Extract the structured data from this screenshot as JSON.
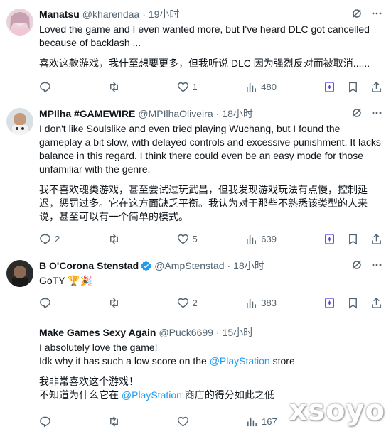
{
  "posts": [
    {
      "name": "Manatsu",
      "handle": "@kharendaa",
      "time": "19小时",
      "verified": false,
      "paragraphs": [
        "Loved the game and I even wanted more, but I've heard DLC got cancelled because of backlash ...",
        "喜欢这款游戏，我什至想要更多，但我听说 DLC 因为强烈反对而被取消......"
      ],
      "replies": "",
      "retweets": "",
      "likes": "1",
      "views": "480"
    },
    {
      "name": "MPIlha #GAMEWIRE",
      "handle": "@MPIlhaOliveira",
      "time": "18小时",
      "verified": false,
      "paragraphs": [
        "I don't like Soulslike and even tried playing Wuchang, but I found the gameplay a bit slow, with delayed controls and excessive punishment. It lacks balance in this regard. I think there could even be an easy mode for those unfamiliar with the genre.",
        "我不喜欢魂类游戏，甚至尝试过玩武昌，但我发现游戏玩法有点慢，控制延迟，惩罚过多。它在这方面缺乏平衡。我认为对于那些不熟悉该类型的人来说，甚至可以有一个简单的模式。"
      ],
      "replies": "2",
      "retweets": "",
      "likes": "5",
      "views": "639"
    },
    {
      "name": "B O'Corona Stenstad",
      "handle": "@AmpStenstad",
      "time": "18小时",
      "verified": true,
      "paragraphs": [
        "GoTY 🏆🎉"
      ],
      "replies": "",
      "retweets": "",
      "likes": "2",
      "views": "383"
    },
    {
      "name": "Make Games Sexy Again",
      "handle": "@Puck6699",
      "time": "15小时",
      "verified": false,
      "lines_en": {
        "l1": "I absolutely love the game!",
        "l2a": "Idk why it has such a low score on the ",
        "l2link": "@PlayStation",
        "l2b": " store"
      },
      "lines_zh": {
        "l1": "我非常喜欢这个游戏！",
        "l2a": "不知道为什么它在 ",
        "l2link": "@PlayStation",
        "l2b": " 商店的得分如此之低"
      },
      "views": "167"
    }
  ],
  "watermark": "xsoyo",
  "colors": {
    "link": "#1d9bf0",
    "muted": "#536471",
    "verified": "#1d9bf0",
    "grok": "#5b3fd6"
  }
}
